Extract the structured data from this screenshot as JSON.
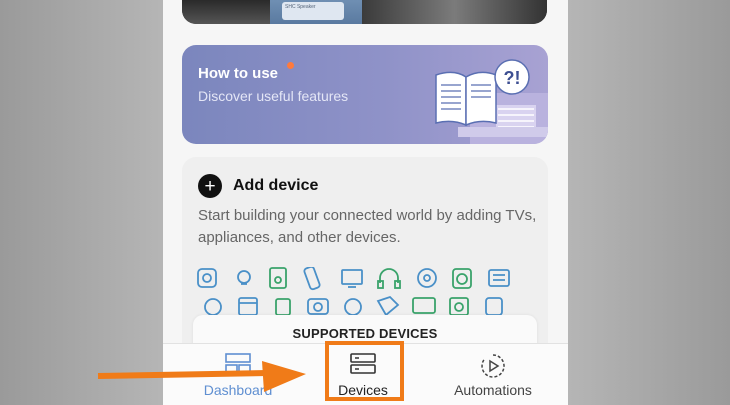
{
  "colors": {
    "accent_orange": "#f07b18",
    "howto_gradient_start": "#7b86bd",
    "howto_gradient_end": "#a8a2d3",
    "dashboard_blue": "#5f8fd1",
    "notification_dot": "#ff7a3c"
  },
  "banner": {
    "tile_text": "SHC Speaker"
  },
  "how_to_use": {
    "title": "How to use",
    "subtitle": "Discover useful features",
    "illustration_icon": "open-book-question-icon"
  },
  "add_device": {
    "icon": "plus-circle-icon",
    "title": "Add device",
    "description": "Start building your connected world by adding TVs, appliances, and other devices.",
    "device_icons": [
      "speaker-icon",
      "bulb-icon",
      "audio-icon",
      "remote-icon",
      "monitor-icon",
      "headphones-icon",
      "sensor-icon",
      "washer-icon",
      "panel-icon",
      "vacuum-icon",
      "oven-icon",
      "box-icon",
      "camera-icon",
      "robot-icon",
      "dryer-icon",
      "tv-icon",
      "fridge-icon",
      "outlet-icon"
    ],
    "supported_label": "SUPPORTED DEVICES"
  },
  "bottom_nav": {
    "items": [
      {
        "label": "Dashboard",
        "icon": "dashboard-icon"
      },
      {
        "label": "Devices",
        "icon": "devices-icon"
      },
      {
        "label": "Automations",
        "icon": "automations-icon"
      }
    ],
    "highlighted": "Devices"
  }
}
